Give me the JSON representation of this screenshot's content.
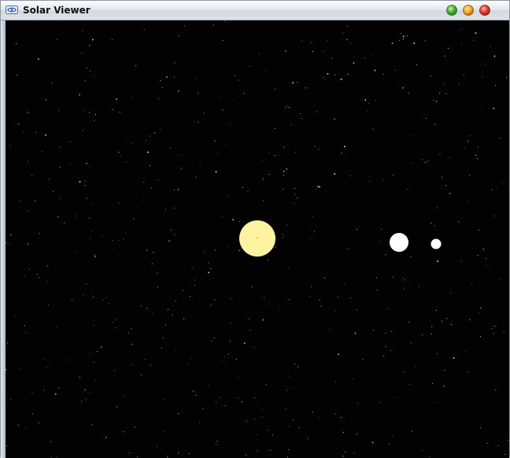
{
  "window": {
    "title": "Solar Viewer",
    "icon": "solar-viewer-app-icon",
    "controls": [
      {
        "name": "maximize-button",
        "icon": "green-circle-icon",
        "color": "#3fae2a"
      },
      {
        "name": "minimize-button",
        "icon": "orange-circle-icon",
        "color": "#f0a21f"
      },
      {
        "name": "close-button",
        "icon": "red-circle-icon",
        "color": "#e0362b"
      }
    ]
  },
  "scene": {
    "background_color": "#020202",
    "star_color": "#ffffff",
    "sun": {
      "name": "sun",
      "color": "#fdf3a0"
    },
    "planets": [
      {
        "name": "planet-large",
        "color": "#ffffff"
      },
      {
        "name": "planet-small",
        "color": "#ffffff"
      }
    ]
  }
}
